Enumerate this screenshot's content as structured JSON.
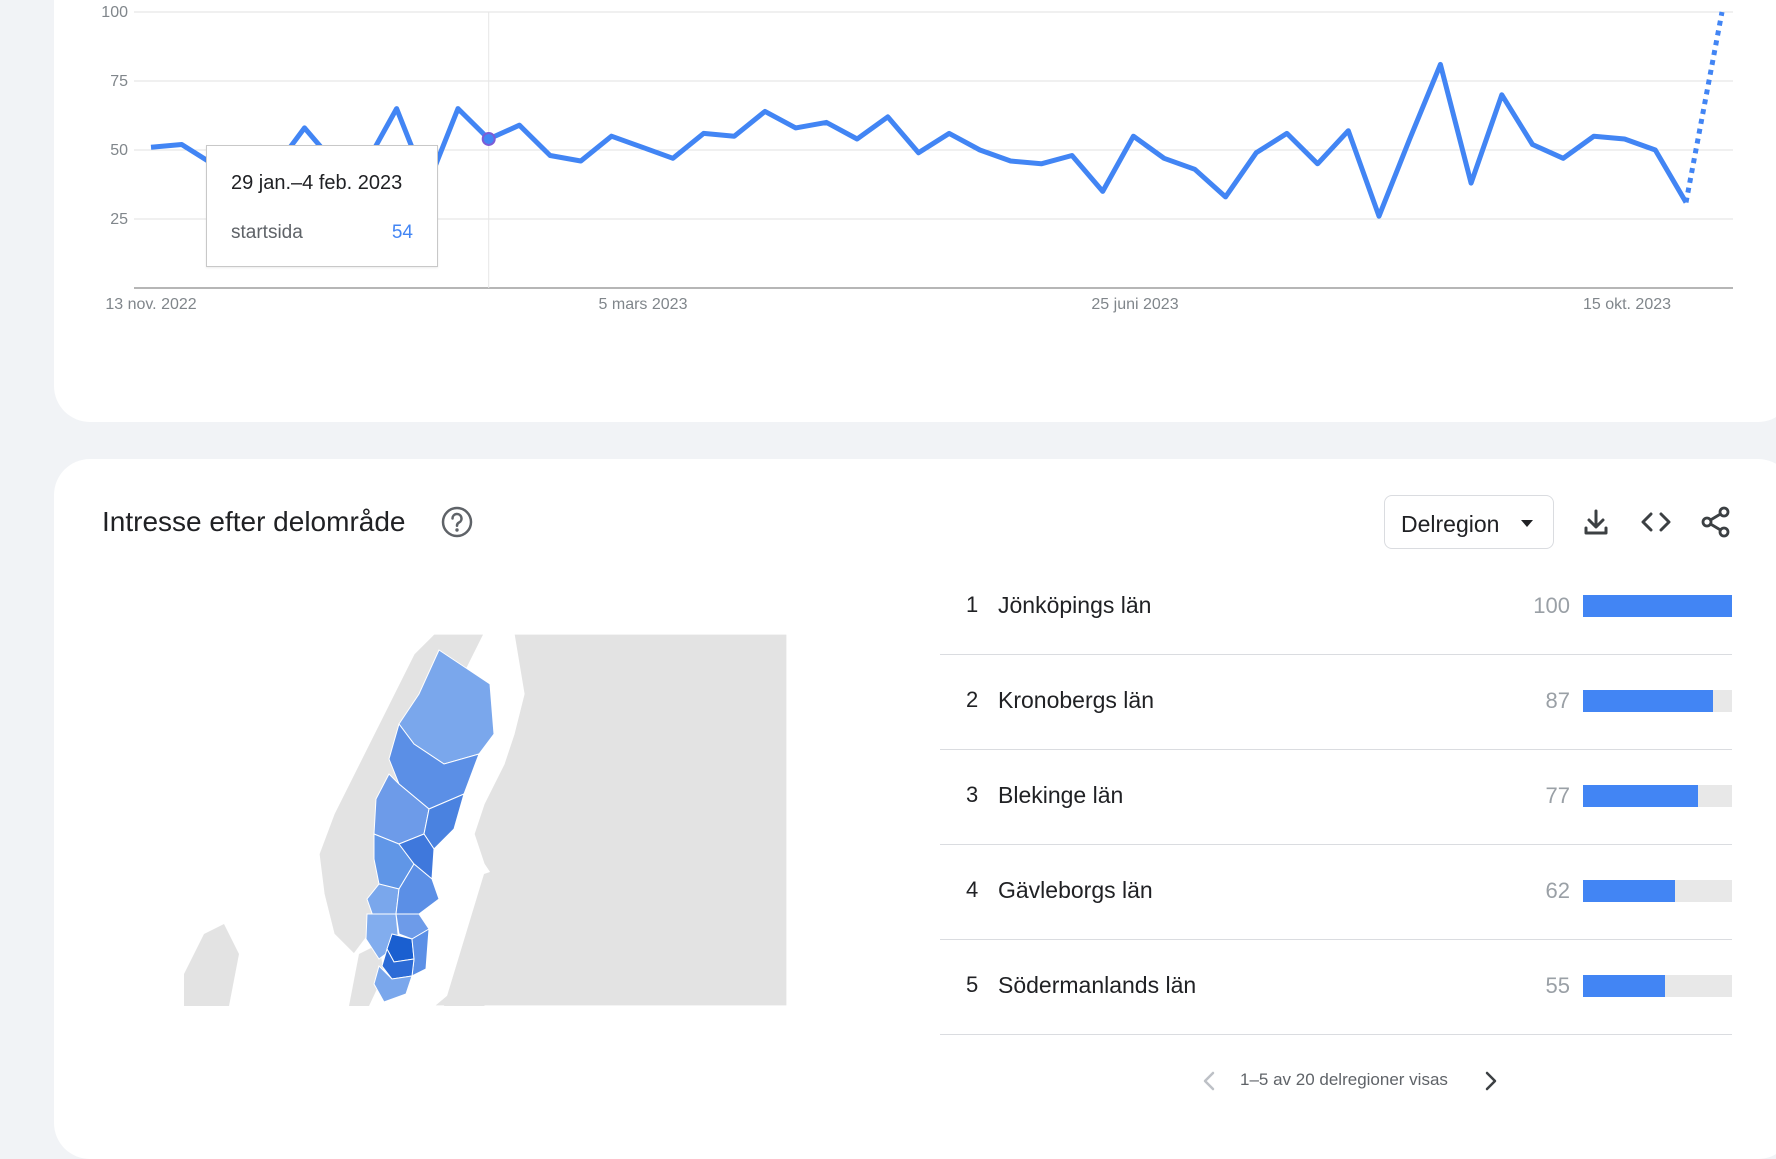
{
  "chart_data": {
    "type": "line",
    "y_ticks": [
      "100",
      "75",
      "50",
      "25"
    ],
    "ylim": [
      0,
      100
    ],
    "x_tick_labels": [
      "13 nov. 2022",
      "5 mars 2023",
      "25 juni 2023",
      "15 okt. 2023"
    ],
    "grid": true,
    "series": [
      {
        "name": "startsida",
        "color": "#4285f4",
        "values": [
          51,
          52,
          45,
          42,
          43,
          58,
          45,
          45,
          65,
          37,
          65,
          54,
          59,
          48,
          46,
          55,
          51,
          47,
          56,
          55,
          64,
          58,
          60,
          54,
          62,
          49,
          56,
          50,
          46,
          45,
          48,
          35,
          55,
          47,
          43,
          33,
          49,
          56,
          45,
          57,
          26,
          54,
          81,
          38,
          70,
          52,
          47,
          55,
          54,
          50,
          31
        ],
        "partial_end_value": 100
      }
    ],
    "tooltip": {
      "date": "29 jan.–4 feb. 2023",
      "term": "startsida",
      "value": "54",
      "index": 11
    }
  },
  "section": {
    "title": "Intresse efter delområde",
    "help_icon": "help-circle-icon"
  },
  "toolbar": {
    "dropdown_label": "Delregion",
    "icons": [
      "download-icon",
      "embed-code-icon",
      "share-icon"
    ]
  },
  "regions": [
    {
      "rank": "1",
      "name": "Jönköpings län",
      "value": "100",
      "pct": 100
    },
    {
      "rank": "2",
      "name": "Kronobergs län",
      "value": "87",
      "pct": 87
    },
    {
      "rank": "3",
      "name": "Blekinge län",
      "value": "77",
      "pct": 77
    },
    {
      "rank": "4",
      "name": "Gävleborgs län",
      "value": "62",
      "pct": 62
    },
    {
      "rank": "5",
      "name": "Södermanlands län",
      "value": "55",
      "pct": 55
    }
  ],
  "pagination": {
    "text": "1–5 av 20 delregioner visas"
  },
  "colors": {
    "accent": "#4285f4",
    "map_land": "#e3e3e3",
    "map_light": "#7aa7ec",
    "map_mid": "#5b8fe6",
    "map_dark": "#1a5fd0"
  }
}
